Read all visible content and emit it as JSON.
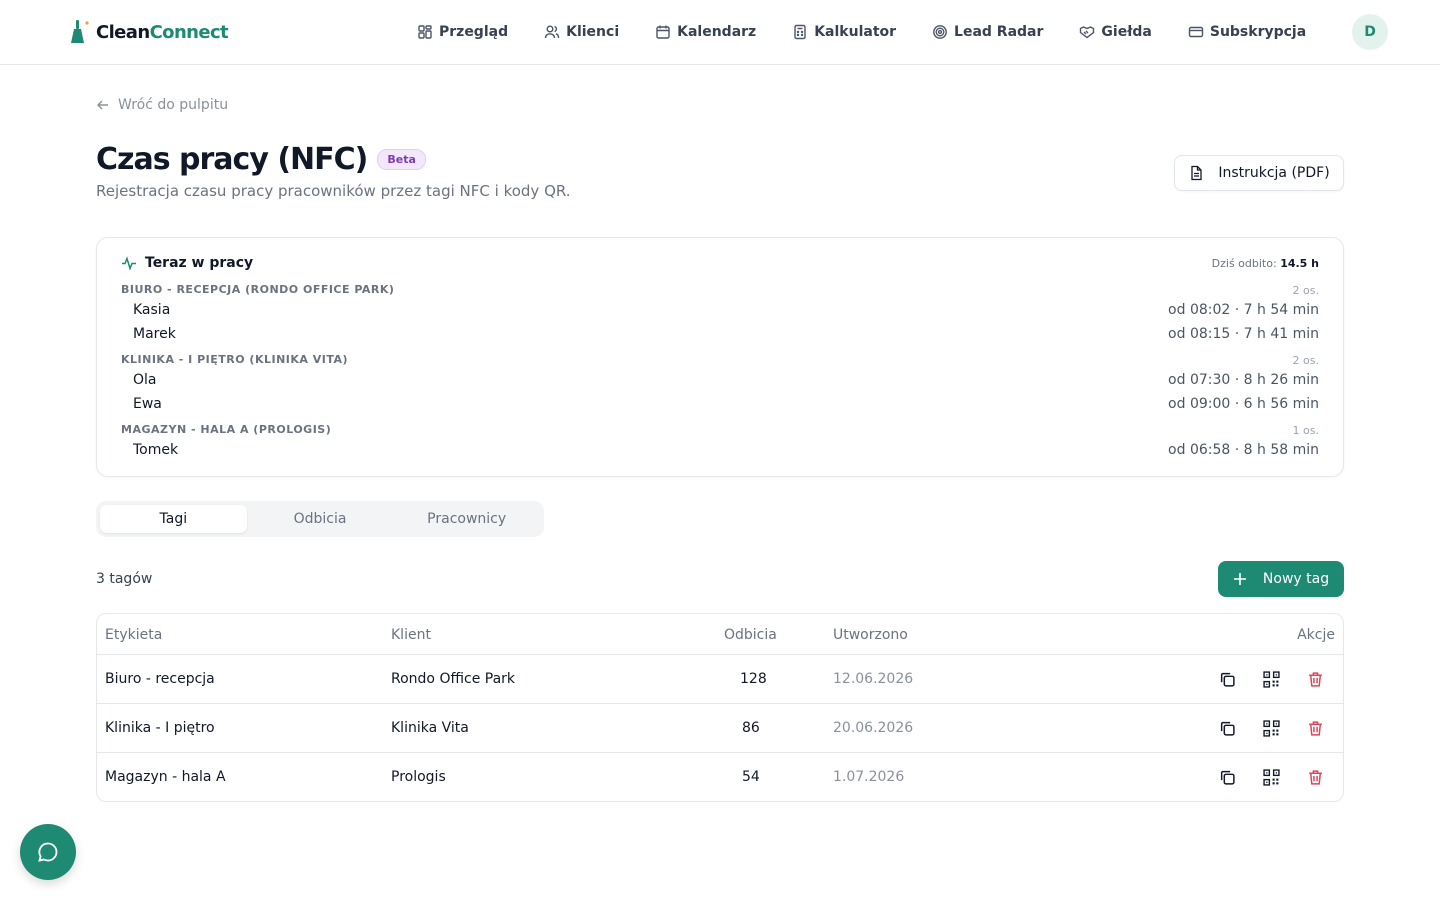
{
  "brand": {
    "part1": "Clean",
    "part2": "Connect"
  },
  "nav": [
    {
      "label": "Przegląd",
      "icon": "grid-icon"
    },
    {
      "label": "Klienci",
      "icon": "users-icon"
    },
    {
      "label": "Kalendarz",
      "icon": "calendar-icon"
    },
    {
      "label": "Kalkulator",
      "icon": "calculator-icon"
    },
    {
      "label": "Lead Radar",
      "icon": "radar-icon"
    },
    {
      "label": "Giełda",
      "icon": "handshake-icon"
    },
    {
      "label": "Subskrypcja",
      "icon": "credit-card-icon"
    }
  ],
  "user": {
    "initial": "D"
  },
  "back_label": "Wróć do pulpitu",
  "page": {
    "title": "Czas pracy (NFC)",
    "badge": "Beta",
    "subtitle": "Rejestracja czasu pracy pracowników przez tagi NFC i kody QR.",
    "pdf_button": "Instrukcja (PDF)"
  },
  "now_working": {
    "title": "Teraz w pracy",
    "today_label": "Dziś odbito:",
    "today_value": "14.5 h",
    "groups": [
      {
        "label": "BIURO - RECEPCJA (RONDO OFFICE PARK)",
        "count": "2 os.",
        "workers": [
          {
            "name": "Kasia",
            "time": "od 08:02 · 7 h 54 min"
          },
          {
            "name": "Marek",
            "time": "od 08:15 · 7 h 41 min"
          }
        ]
      },
      {
        "label": "KLINIKA - I PIĘTRO (KLINIKA VITA)",
        "count": "2 os.",
        "workers": [
          {
            "name": "Ola",
            "time": "od 07:30 · 8 h 26 min"
          },
          {
            "name": "Ewa",
            "time": "od 09:00 · 6 h 56 min"
          }
        ]
      },
      {
        "label": "MAGAZYN - HALA A (PROLOGIS)",
        "count": "1 os.",
        "workers": [
          {
            "name": "Tomek",
            "time": "od 06:58 · 8 h 58 min"
          }
        ]
      }
    ]
  },
  "tabs": [
    {
      "label": "Tagi",
      "active": true
    },
    {
      "label": "Odbicia",
      "active": false
    },
    {
      "label": "Pracownicy",
      "active": false
    }
  ],
  "tags_count": "3 tagów",
  "new_tag_button": "Nowy tag",
  "table": {
    "headers": {
      "label": "Etykieta",
      "client": "Klient",
      "scans": "Odbicia",
      "created": "Utworzono",
      "actions": "Akcje"
    },
    "rows": [
      {
        "label": "Biuro - recepcja",
        "client": "Rondo Office Park",
        "scans": "128",
        "created": "12.06.2026"
      },
      {
        "label": "Klinika - I piętro",
        "client": "Klinika Vita",
        "scans": "86",
        "created": "20.06.2026"
      },
      {
        "label": "Magazyn - hala A",
        "client": "Prologis",
        "scans": "54",
        "created": "1.07.2026"
      }
    ]
  },
  "colors": {
    "accent": "#1e8a73",
    "danger": "#e0435c",
    "badge_bg": "#f3e8fb",
    "badge_text": "#7e3bb3"
  }
}
